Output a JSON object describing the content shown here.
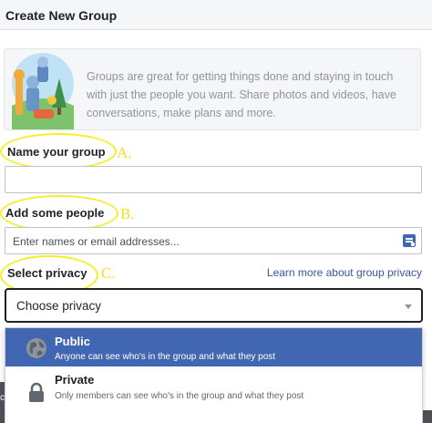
{
  "header": {
    "title": "Create New Group"
  },
  "intro": {
    "text": "Groups are great for getting things done and staying in touch with just the people you want. Share photos and videos, have conversations, make plans and more."
  },
  "fields": {
    "name_label": "Name your group",
    "name_value": "",
    "people_label": "Add some people",
    "people_placeholder": "Enter names or email addresses...",
    "privacy_label": "Select privacy",
    "learn_more": "Learn more about group privacy"
  },
  "annotations": {
    "a": "A.",
    "b": "B.",
    "c": "C."
  },
  "privacy_select": {
    "value": "Choose privacy",
    "options": [
      {
        "title": "Public",
        "desc": "Anyone can see who's in the group and what they post",
        "icon": "globe-icon",
        "highlighted": true
      },
      {
        "title": "Private",
        "desc": "Only members can see who's in the group and what they post",
        "icon": "lock-icon",
        "highlighted": false
      }
    ]
  },
  "background": {
    "partial_text": "c"
  },
  "colors": {
    "accent": "#4267b2",
    "link": "#365899",
    "annotation": "#f3ef2b"
  }
}
